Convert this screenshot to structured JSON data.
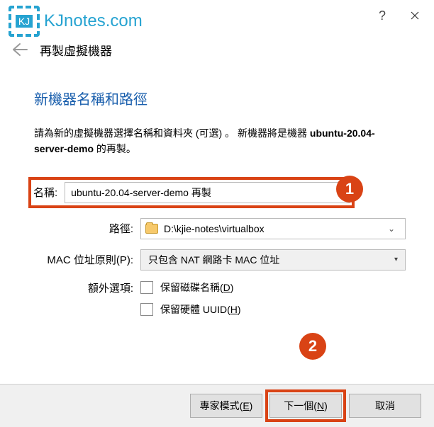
{
  "watermark": {
    "box": "KJ",
    "text": "KJnotes.com"
  },
  "window": {
    "title": "再製虛擬機器"
  },
  "section": {
    "title": "新機器名稱和路徑",
    "description_prefix": "請為新的虛擬機器選擇名稱和資料夾 (可選) 。 新機器將是機器 ",
    "description_bold": "ubuntu-20.04-server-demo",
    "description_suffix": " 的再製。"
  },
  "form": {
    "name": {
      "label": "名稱:",
      "value": "ubuntu-20.04-server-demo 再製"
    },
    "path": {
      "label": "路徑:",
      "value": "D:\\kjie-notes\\virtualbox"
    },
    "mac": {
      "label": "MAC 位址原則(P):",
      "value": "只包含 NAT 網路卡 MAC 位址"
    },
    "extra": {
      "label": "額外選項:",
      "opt1_prefix": "保留磁碟名稱(",
      "opt1_key": "D",
      "opt1_suffix": ")",
      "opt2_prefix": "保留硬體 UUID(",
      "opt2_key": "H",
      "opt2_suffix": ")"
    }
  },
  "badges": {
    "one": "1",
    "two": "2"
  },
  "footer": {
    "expert_prefix": "專家模式(",
    "expert_key": "E",
    "expert_suffix": ")",
    "next_prefix": "下一個(",
    "next_key": "N",
    "next_suffix": ")",
    "cancel": "取消"
  }
}
